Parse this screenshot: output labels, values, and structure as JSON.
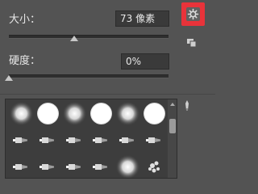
{
  "size": {
    "label": "大小：",
    "value": "73 像素",
    "slider_fraction": 0.41
  },
  "hardness": {
    "label": "硬度：",
    "value": "0%",
    "slider_fraction": 0.0
  },
  "settings": {
    "icon": "gear-icon",
    "highlight_color": "#e8333a"
  },
  "brushes": {
    "row1": [
      "soft-round",
      "hard-round",
      "soft-round",
      "hard-round",
      "soft-round",
      "hard-round"
    ],
    "row2": [
      "brush-tip",
      "brush-tip",
      "brush-tip",
      "brush-tip",
      "brush-tip",
      "brush-tip"
    ],
    "row3": [
      "brush-tip",
      "brush-tip",
      "brush-tip",
      "brush-tip",
      "soft-round",
      "scatter"
    ]
  }
}
